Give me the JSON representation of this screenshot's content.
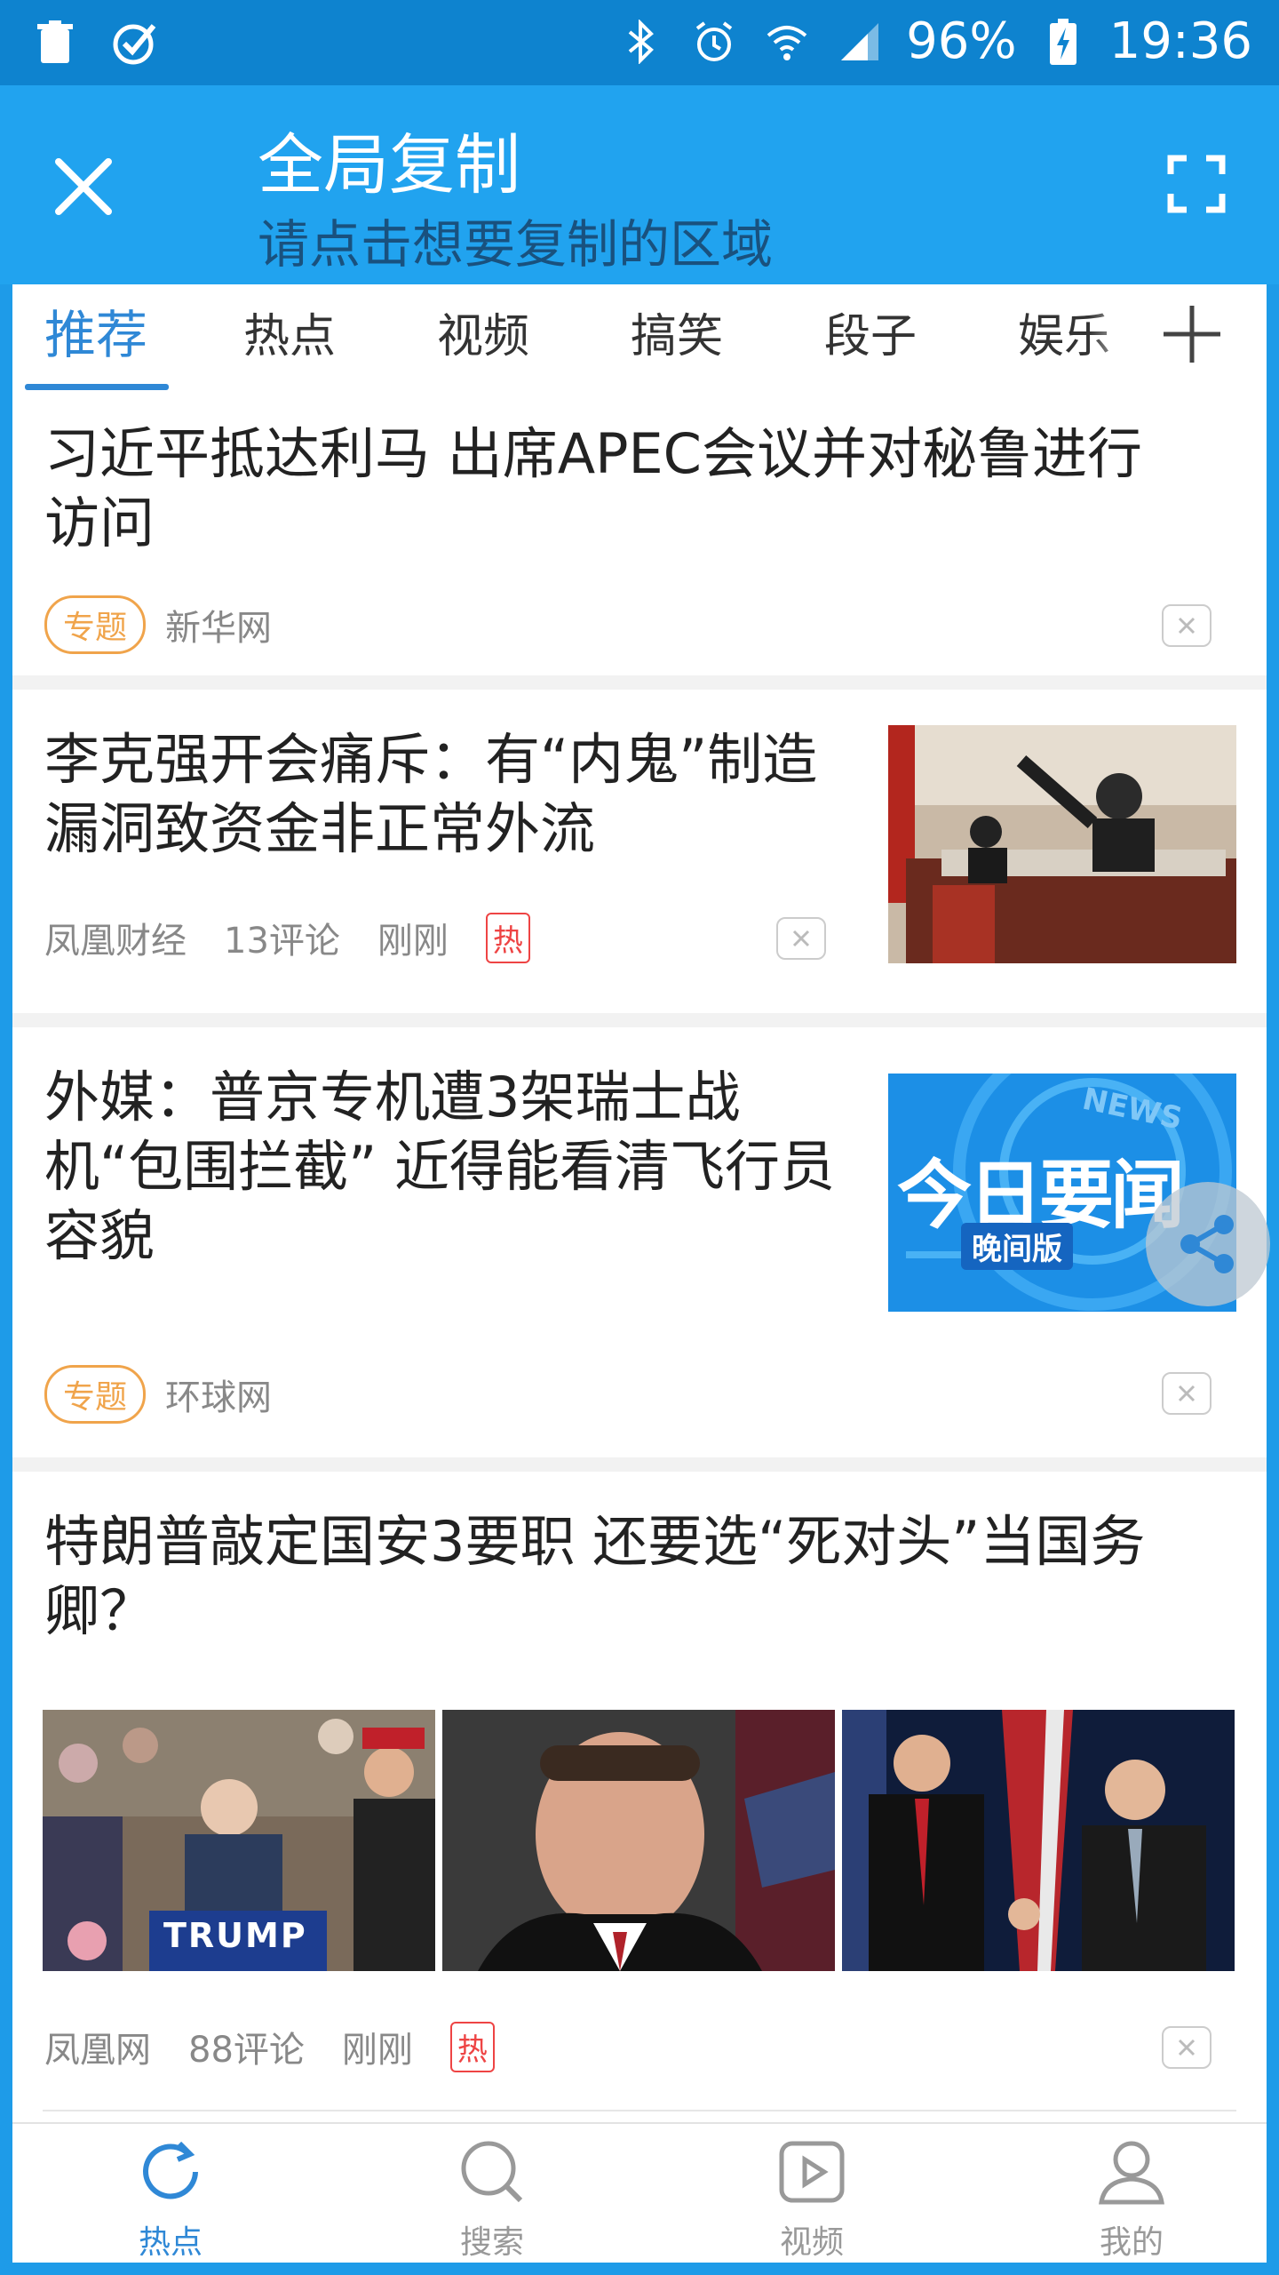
{
  "status_bar": {
    "battery": "96%",
    "time": "19:36",
    "left_icons": [
      "trash-icon",
      "check-circle-icon"
    ],
    "right_icons": [
      "bluetooth-icon",
      "alarm-icon",
      "wifi-icon",
      "signal-icon",
      "battery-charging-icon"
    ]
  },
  "overlay": {
    "title": "全局复制",
    "subtitle": "请点击想要复制的区域"
  },
  "tabs": {
    "items": [
      "推荐",
      "热点",
      "视频",
      "搞笑",
      "段子",
      "娱乐"
    ],
    "active_index": 0
  },
  "articles": [
    {
      "title_line1": "习近平抵达利马 出席APEC会议并对秘鲁进行",
      "title_line2": "访问",
      "tag": "专题",
      "source": "新华网"
    },
    {
      "title_line1": "李克强开会痛斥：有“内鬼”制造",
      "title_line2": "漏洞致资金非正常外流",
      "source": "凤凰财经",
      "comments": "13评论",
      "time": "刚刚",
      "hot": "热"
    },
    {
      "title_line1": "外媒：普京专机遭3架瑞士战",
      "title_line2": "机“包围拦截” 近得能看清飞行员",
      "title_line3": "容貌",
      "tag": "专题",
      "source": "环球网",
      "thumb_badge": "NEWS",
      "thumb_title": "今日要闻",
      "thumb_sub": "晚间版"
    },
    {
      "title_line1": "特朗普敲定国安3要职 还要选“死对头”当国务",
      "title_line2": "卿？",
      "source": "凤凰网",
      "comments": "88评论",
      "time": "刚刚",
      "hot": "热",
      "photo1_sign": "TRUMP"
    }
  ],
  "bottom_nav": {
    "items": [
      "热点",
      "搜索",
      "视频",
      "我的"
    ],
    "active_index": 0
  },
  "colors": {
    "header_blue": "#21a3ef",
    "status_blue": "#0e83cf",
    "accent": "#2f88d6",
    "tag_orange": "#f0a44b",
    "hot_red": "#e44"
  }
}
